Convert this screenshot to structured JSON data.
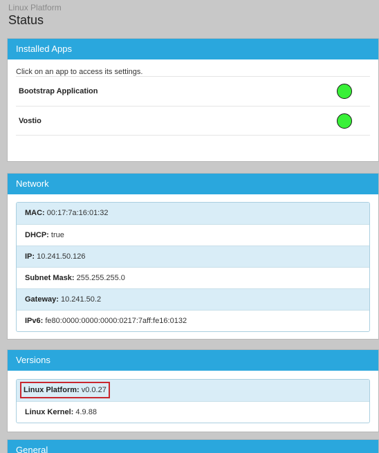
{
  "header": {
    "platform": "Linux Platform",
    "title": "Status"
  },
  "installed_apps": {
    "heading": "Installed Apps",
    "hint": "Click on an app to access its settings.",
    "apps": [
      {
        "name": "Bootstrap Application",
        "status_color": "#39f038"
      },
      {
        "name": "Vostio",
        "status_color": "#39f038"
      }
    ]
  },
  "network": {
    "heading": "Network",
    "rows": [
      {
        "label": "MAC:",
        "value": "00:17:7a:16:01:32"
      },
      {
        "label": "DHCP:",
        "value": "true"
      },
      {
        "label": "IP:",
        "value": "10.241.50.126"
      },
      {
        "label": "Subnet Mask:",
        "value": "255.255.255.0"
      },
      {
        "label": "Gateway:",
        "value": "10.241.50.2"
      },
      {
        "label": "IPv6:",
        "value": "fe80:0000:0000:0000:0217:7aff:fe16:0132"
      }
    ]
  },
  "versions": {
    "heading": "Versions",
    "rows": [
      {
        "label": "Linux Platform:",
        "value": "v0.0.27"
      },
      {
        "label": "Linux Kernel:",
        "value": "4.9.88"
      }
    ]
  },
  "general": {
    "heading": "General"
  },
  "colors": {
    "accent": "#2aa7dd",
    "status_ok": "#39f038",
    "highlight": "#c8272e"
  }
}
